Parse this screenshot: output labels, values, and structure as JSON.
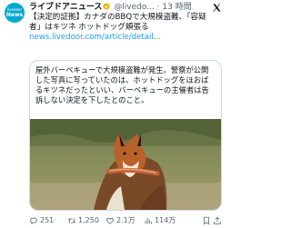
{
  "account": {
    "avatar_line1": "livedoor",
    "avatar_line2": "News",
    "name": "ライブドアニュース",
    "handle": "@livedo...",
    "separator": "·",
    "time": "13 時間"
  },
  "tweet": {
    "line1": "【決定的証拠】カナダのBBQで大規模盗難、「容疑",
    "line2": "者」はキツネ ホットドッグ頬張る",
    "link": "news.livedoor.com/article/detail..."
  },
  "card": {
    "text": "屋外バーベキューで大規模盗難が発生。警察が公開した写真に写っていたのは、ホットドッグをほおばるキツネだったといい、バーベキューの主催者は告訴しない決定を下したとのこと。",
    "image_subject": "fox-holding-hot-dog"
  },
  "actions": {
    "reply_count": "251",
    "retweet_count": "1,250",
    "like_count": "2.1万",
    "view_count": "114万"
  },
  "colors": {
    "accent": "#1d9bf0",
    "text": "#0f1419",
    "muted": "#536471",
    "border": "#cfd9de",
    "avatar": "#00a8cf",
    "badge": "#e8b400"
  },
  "icons": [
    "x-logo-icon",
    "verified-badge-icon",
    "reply-icon",
    "retweet-icon",
    "like-icon",
    "views-icon",
    "bookmark-icon",
    "share-icon"
  ]
}
